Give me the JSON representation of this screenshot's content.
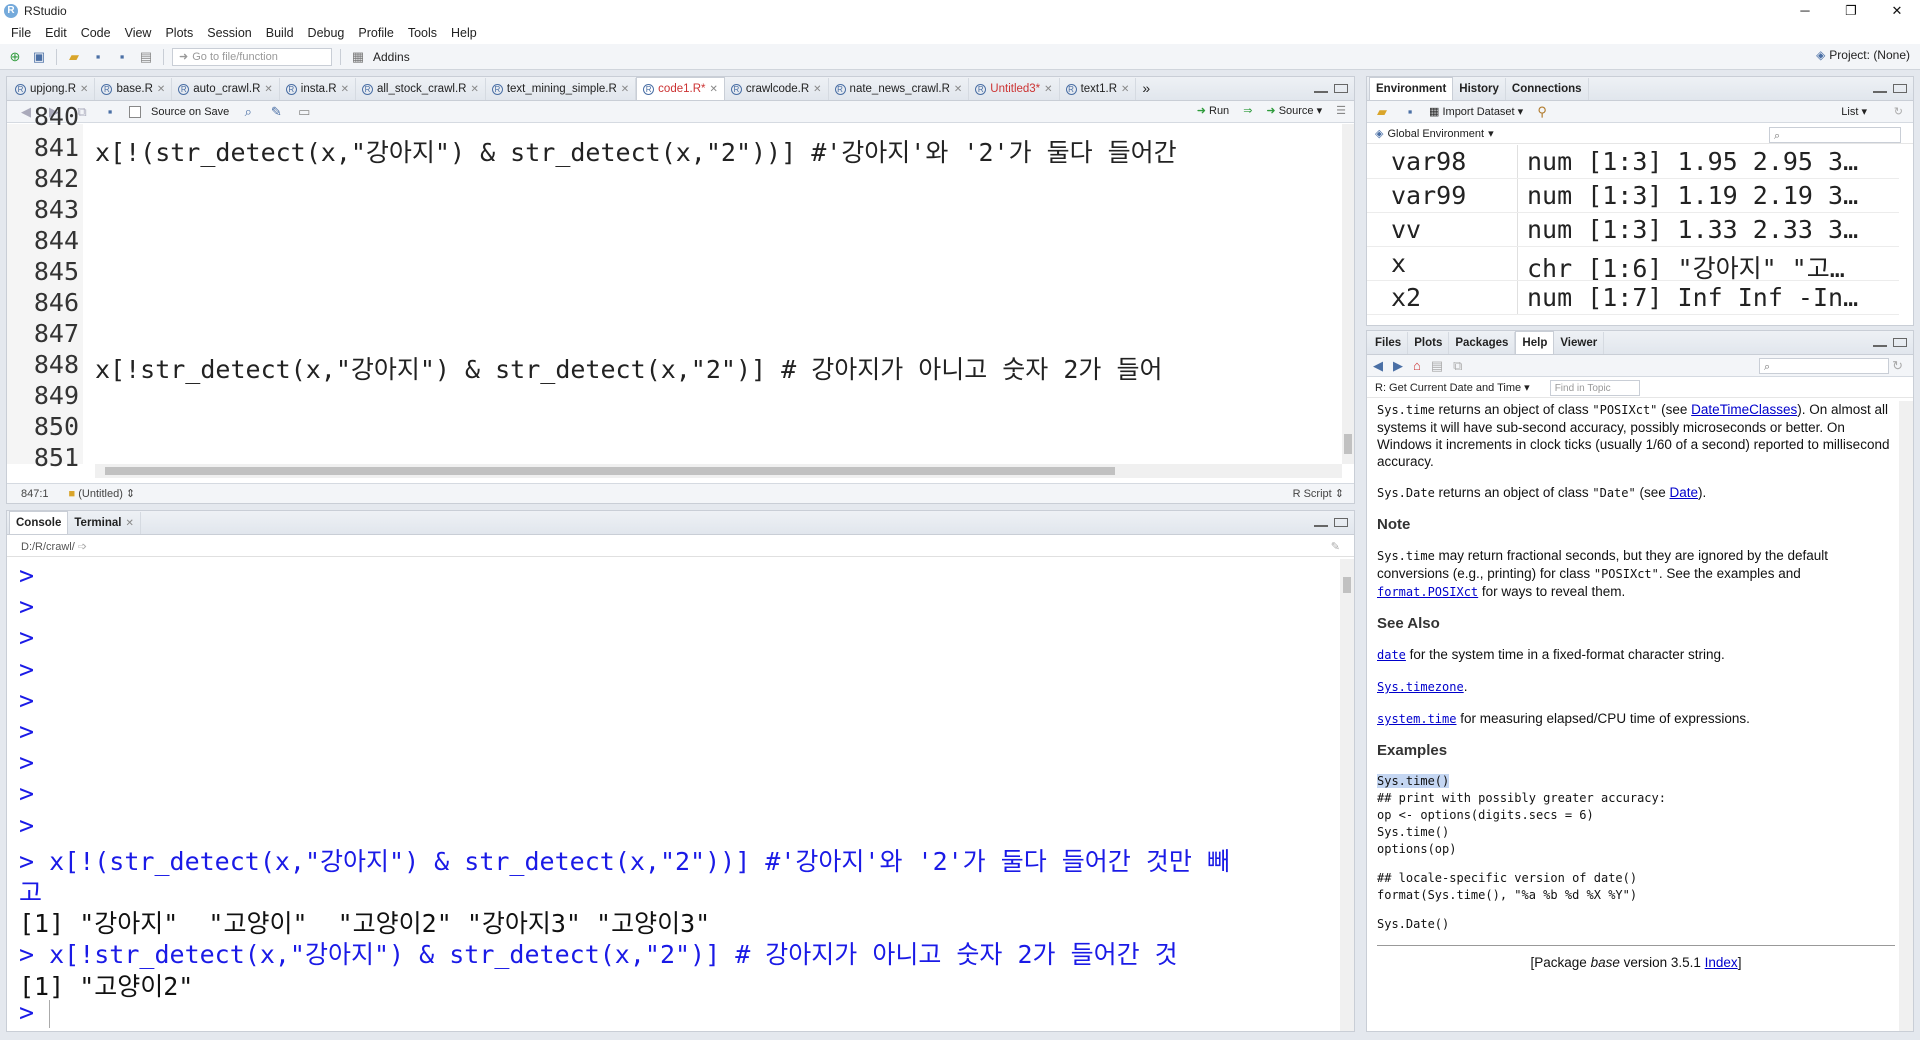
{
  "window": {
    "title": "RStudio",
    "controls": [
      "─",
      "❐",
      "✕"
    ]
  },
  "menu": [
    "File",
    "Edit",
    "Code",
    "View",
    "Plots",
    "Session",
    "Build",
    "Debug",
    "Profile",
    "Tools",
    "Help"
  ],
  "toolbar": {
    "goto_placeholder": "Go to file/function",
    "addins": "Addins",
    "project": "Project: (None)"
  },
  "editor": {
    "tabs": [
      {
        "label": "upjong.R",
        "active": false,
        "modified": false
      },
      {
        "label": "base.R",
        "active": false,
        "modified": false
      },
      {
        "label": "auto_crawl.R",
        "active": false,
        "modified": false
      },
      {
        "label": "insta.R",
        "active": false,
        "modified": false
      },
      {
        "label": "all_stock_crawl.R",
        "active": false,
        "modified": false
      },
      {
        "label": "text_mining_simple.R",
        "active": false,
        "modified": false
      },
      {
        "label": "code1.R*",
        "active": true,
        "modified": true
      },
      {
        "label": "crawlcode.R",
        "active": false,
        "modified": false
      },
      {
        "label": "nate_news_crawl.R",
        "active": false,
        "modified": false
      },
      {
        "label": "Untitled3*",
        "active": false,
        "modified": true
      },
      {
        "label": "text1.R",
        "active": false,
        "modified": false
      }
    ],
    "source_on_save": "Source on Save",
    "run": "Run",
    "source": "Source",
    "lines": [
      {
        "num": "840",
        "code": ""
      },
      {
        "num": "841",
        "code": "x[!(str_detect(x,\"강아지\") & str_detect(x,\"2\"))] #'강아지'와 '2'가 둘다 들어간"
      },
      {
        "num": "842",
        "code": ""
      },
      {
        "num": "843",
        "code": ""
      },
      {
        "num": "844",
        "code": ""
      },
      {
        "num": "845",
        "code": ""
      },
      {
        "num": "846",
        "code": ""
      },
      {
        "num": "847",
        "code": ""
      },
      {
        "num": "848",
        "code": "x[!str_detect(x,\"강아지\") & str_detect(x,\"2\")] # 강아지가 아니고 숫자 2가 들어"
      },
      {
        "num": "849",
        "code": ""
      },
      {
        "num": "850",
        "code": ""
      },
      {
        "num": "851",
        "code": ""
      }
    ],
    "cursor": "847:1",
    "scope": "(Untitled)",
    "filetype": "R Script"
  },
  "console": {
    "tabs": [
      "Console",
      "Terminal"
    ],
    "path": "D:/R/crawl/",
    "lines": [
      {
        "text": ">",
        "kind": "prompt"
      },
      {
        "text": ">",
        "kind": "prompt"
      },
      {
        "text": ">",
        "kind": "prompt"
      },
      {
        "text": ">",
        "kind": "prompt"
      },
      {
        "text": ">",
        "kind": "prompt"
      },
      {
        "text": ">",
        "kind": "prompt"
      },
      {
        "text": ">",
        "kind": "prompt"
      },
      {
        "text": ">",
        "kind": "prompt"
      },
      {
        "text": ">",
        "kind": "prompt"
      },
      {
        "text": "> x[!(str_detect(x,\"강아지\") & str_detect(x,\"2\"))] #'강아지'와 '2'가 둘다 들어간 것만 빼",
        "kind": "prompt"
      },
      {
        "text": "고",
        "kind": "prompt"
      },
      {
        "text": "[1] \"강아지\"  \"고양이\"  \"고양이2\" \"강아지3\" \"고양이3\"",
        "kind": "out"
      },
      {
        "text": "> x[!str_detect(x,\"강아지\") & str_detect(x,\"2\")] # 강아지가 아니고 숫자 2가 들어간 것",
        "kind": "prompt"
      },
      {
        "text": "[1] \"고양이2\"",
        "kind": "out"
      },
      {
        "text": ">",
        "kind": "prompt"
      }
    ]
  },
  "environment": {
    "tabs": [
      "Environment",
      "History",
      "Connections"
    ],
    "import_dataset": "Import Dataset",
    "list_view": "List",
    "scope": "Global Environment",
    "rows": [
      {
        "name": "var98",
        "value": "num [1:3] 1.95 2.95 3…"
      },
      {
        "name": "var99",
        "value": "num [1:3] 1.19 2.19 3…"
      },
      {
        "name": "vv",
        "value": "num [1:3] 1.33 2.33 3…"
      },
      {
        "name": "x",
        "value": "chr [1:6] \"강아지\" \"고…"
      },
      {
        "name": "x2",
        "value": "num [1:7] Inf Inf -In…"
      }
    ]
  },
  "help": {
    "tabs": [
      "Files",
      "Plots",
      "Packages",
      "Help",
      "Viewer"
    ],
    "topic": "R: Get Current Date and Time",
    "find_placeholder": "Find in Topic",
    "p1_code": "Sys.time",
    "p1_a": " returns an object of class ",
    "p1_code2": "\"POSIXct\"",
    "p1_b": " (see ",
    "p1_link": "DateTimeClasses",
    "p1_c": "). On almost all systems it will have sub-second accuracy, possibly microseconds or better. On Windows it increments in clock ticks (usually 1/60 of a second) reported to millisecond accuracy.",
    "p2_code": "Sys.Date",
    "p2_a": " returns an object of class ",
    "p2_code2": "\"Date\"",
    "p2_b": " (see ",
    "p2_link": "Date",
    "p2_c": ").",
    "note_heading": "Note",
    "note_code": "Sys.time",
    "note_a": " may return fractional seconds, but they are ignored by the default conversions (e.g., printing) for class ",
    "note_code2": "\"POSIXct\"",
    "note_b": ". See the examples and ",
    "note_link": "format.POSIXct",
    "note_c": " for ways to reveal them.",
    "seealso_heading": "See Also",
    "sa1_link": "date",
    "sa1_text": " for the system time in a fixed-format character string.",
    "sa2_link": "Sys.timezone",
    "sa2_text": ".",
    "sa3_link": "system.time",
    "sa3_text": " for measuring elapsed/CPU time of expressions.",
    "examples_heading": "Examples",
    "ex_first": "Sys.time()",
    "ex_block1": "## print with possibly greater accuracy:\nop <- options(digits.secs = 6)\nSys.time()\noptions(op)",
    "ex_block2": "## locale-specific version of date()\nformat(Sys.time(), \"%a %b %d %X %Y\")",
    "ex_block3": "Sys.Date()",
    "footer_a": "[Package ",
    "footer_pkg": "base",
    "footer_b": " version 3.5.1 ",
    "footer_link": "Index",
    "footer_c": "]"
  }
}
